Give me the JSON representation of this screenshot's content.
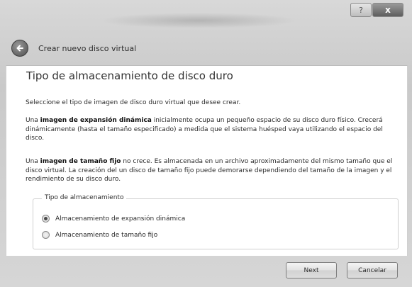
{
  "window": {
    "help_label": "?",
    "close_label": "x"
  },
  "header": {
    "title": "Crear nuevo disco virtual"
  },
  "page": {
    "title": "Tipo de almacenamiento de disco duro",
    "intro": "Seleccione el tipo de imagen de disco duro virtual que desee crear.",
    "dynamic_prefix": "Una ",
    "dynamic_bold": "imagen de expansión dinámica",
    "dynamic_rest": " inicialmente ocupa un pequeño espacio de su disco duro físico. Crecerá dinámicamente (hasta el tamaño especificado) a medida que el sistema huésped vaya utilizando el espacio del disco.",
    "fixed_prefix": "Una ",
    "fixed_bold": "imagen de tamaño fijo",
    "fixed_rest": " no crece. Es almacenada en un archivo aproximadamente del mismo tamaño que el disco virtual. La creación del un disco de tamaño fijo puede demorarse dependiendo del tamaño de la imagen y el rendimiento de su disco duro."
  },
  "storage_group": {
    "legend": "Tipo de almacenamiento",
    "options": [
      {
        "label": "Almacenamiento de expansión dinámica",
        "checked": true
      },
      {
        "label": "Almacenamiento de tamaño fijo",
        "checked": false
      }
    ]
  },
  "footer": {
    "next_label": "Next",
    "cancel_label": "Cancelar"
  },
  "icons": {
    "back": "back-arrow-icon",
    "close": "close-icon",
    "help": "help-icon"
  }
}
